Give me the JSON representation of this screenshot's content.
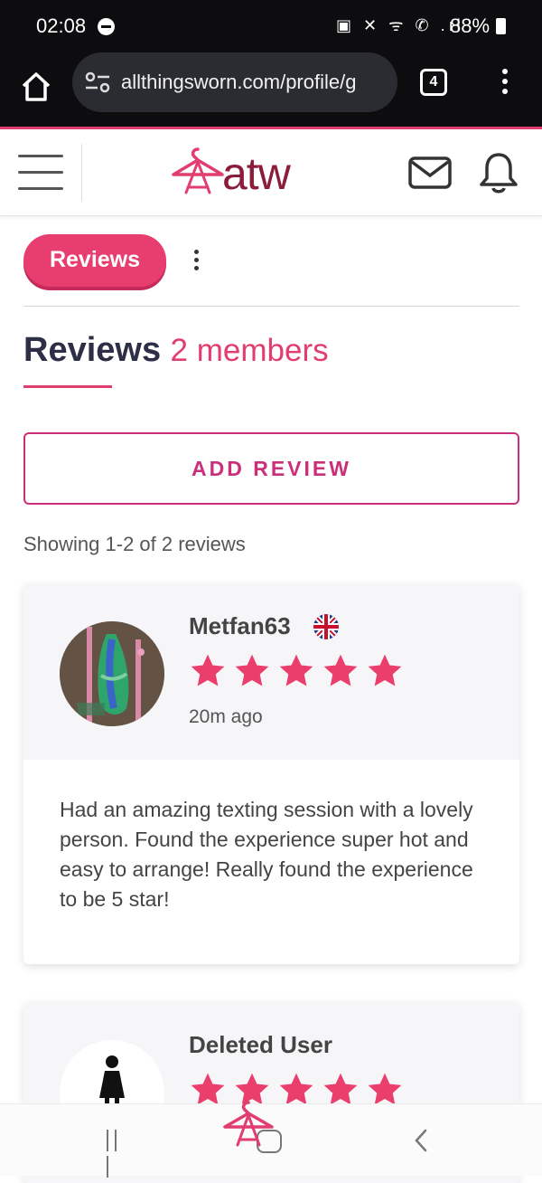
{
  "status_bar": {
    "time": "02:08",
    "icons_text": "▣ ✕ ᯤ ✆ .ıl",
    "battery": "88%"
  },
  "browser": {
    "url": "allthingsworn.com/profile/g",
    "tab_count": "4"
  },
  "site": {
    "logo_text": "atw",
    "brand_color": "#e23d6f",
    "logo_color": "#8c1d3a"
  },
  "tabs": {
    "active_label": "Reviews"
  },
  "section": {
    "title": "Reviews",
    "members": "2 members"
  },
  "add_review_label": "ADD REVIEW",
  "showing_text": "Showing 1-2 of 2 reviews",
  "reviews": [
    {
      "name": "Metfan63",
      "country_flag": "uk-flag-icon",
      "rating": 5,
      "time_ago": "20m ago",
      "text": "Had an amazing texting session with a lovely person. Found the experience super hot and easy to arrange! Really found the experience to be 5 star!"
    },
    {
      "name": "Deleted User",
      "rating": 5
    }
  ],
  "icons": {
    "home": "home-icon",
    "site_settings": "tune-icon",
    "menu": "hamburger-icon",
    "mail": "mail-icon",
    "bell": "bell-icon",
    "more": "kebab-icon",
    "star": "star-icon"
  },
  "colors": {
    "accent": "#e23d6f",
    "button_outline": "#cc2f7a",
    "heading": "#2c2f45"
  }
}
